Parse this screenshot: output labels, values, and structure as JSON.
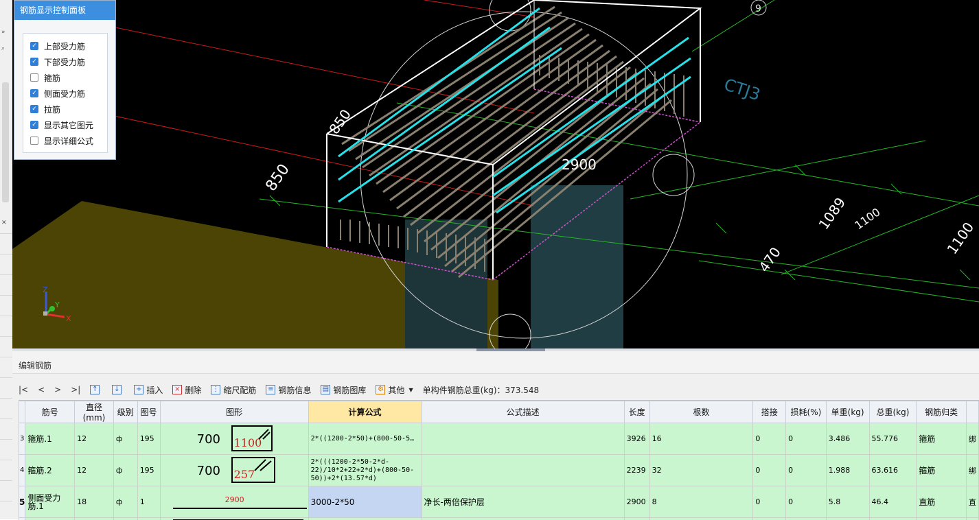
{
  "panel": {
    "title": "钢筋显示控制面板",
    "options": [
      {
        "label": "上部受力筋",
        "checked": true
      },
      {
        "label": "下部受力筋",
        "checked": true
      },
      {
        "label": "箍筋",
        "checked": false
      },
      {
        "label": "侧面受力筋",
        "checked": true
      },
      {
        "label": "拉筋",
        "checked": true
      },
      {
        "label": "显示其它图元",
        "checked": true
      },
      {
        "label": "显示详细公式",
        "checked": false
      }
    ]
  },
  "viewport": {
    "labels": {
      "axis9": "9",
      "ctj": "CTJ3",
      "dim_2900": "2900",
      "dim_850": "850",
      "dim_850b": "850",
      "dim_1089": "1089",
      "dim_1100": "1100",
      "dim_470": "470",
      "dim_1100b": "1100"
    },
    "axes": {
      "z": "Z",
      "y": "Y",
      "x": "X"
    }
  },
  "edit": {
    "title": "编辑钢筋",
    "nav": [
      "|<",
      "<",
      ">",
      ">|"
    ],
    "toolbar": {
      "insert": "插入",
      "delete": "删除",
      "scale": "缩尺配筋",
      "info": "钢筋信息",
      "library": "钢筋图库",
      "other": "其他",
      "total": "单构件钢筋总重(kg)：373.548"
    }
  },
  "table": {
    "headers": [
      "筋号",
      "直径(mm)",
      "级别",
      "图号",
      "图形",
      "计算公式",
      "公式描述",
      "长度",
      "根数",
      "搭接",
      "损耗(%)",
      "单重(kg)",
      "总重(kg)",
      "钢筋归类"
    ],
    "rows": [
      {
        "n": "3",
        "name": "箍筋.1",
        "dia": "12",
        "grade": "ф",
        "fig": "195",
        "shape_a": "700",
        "shape_b": "1100",
        "formula": "2*((1200-2*50)+(800-50-5…",
        "desc": "",
        "len": "3926",
        "count": "16",
        "lap": "0",
        "loss": "0",
        "unit": "3.486",
        "total": "55.776",
        "cls": "箍筋",
        "extra": "绑"
      },
      {
        "n": "4",
        "name": "箍筋.2",
        "dia": "12",
        "grade": "ф",
        "fig": "195",
        "shape_a": "700",
        "shape_b": "257",
        "formula": "2*(((1200-2*50-2*d-22)/10*2+22+2*d)+(800-50-50))+2*(13.57*d)",
        "desc": "",
        "len": "2239",
        "count": "32",
        "lap": "0",
        "loss": "0",
        "unit": "1.988",
        "total": "63.616",
        "cls": "箍筋",
        "extra": "绑"
      },
      {
        "n": "5",
        "name": "侧面受力筋.1",
        "dia": "18",
        "grade": "ф",
        "fig": "1",
        "shape_a": "2900",
        "shape_b": "",
        "formula": "3000-2*50",
        "desc": "净长-两倍保护层",
        "len": "2900",
        "count": "8",
        "lap": "0",
        "loss": "0",
        "unit": "5.8",
        "total": "46.4",
        "cls": "直筋",
        "extra": "直"
      }
    ]
  }
}
